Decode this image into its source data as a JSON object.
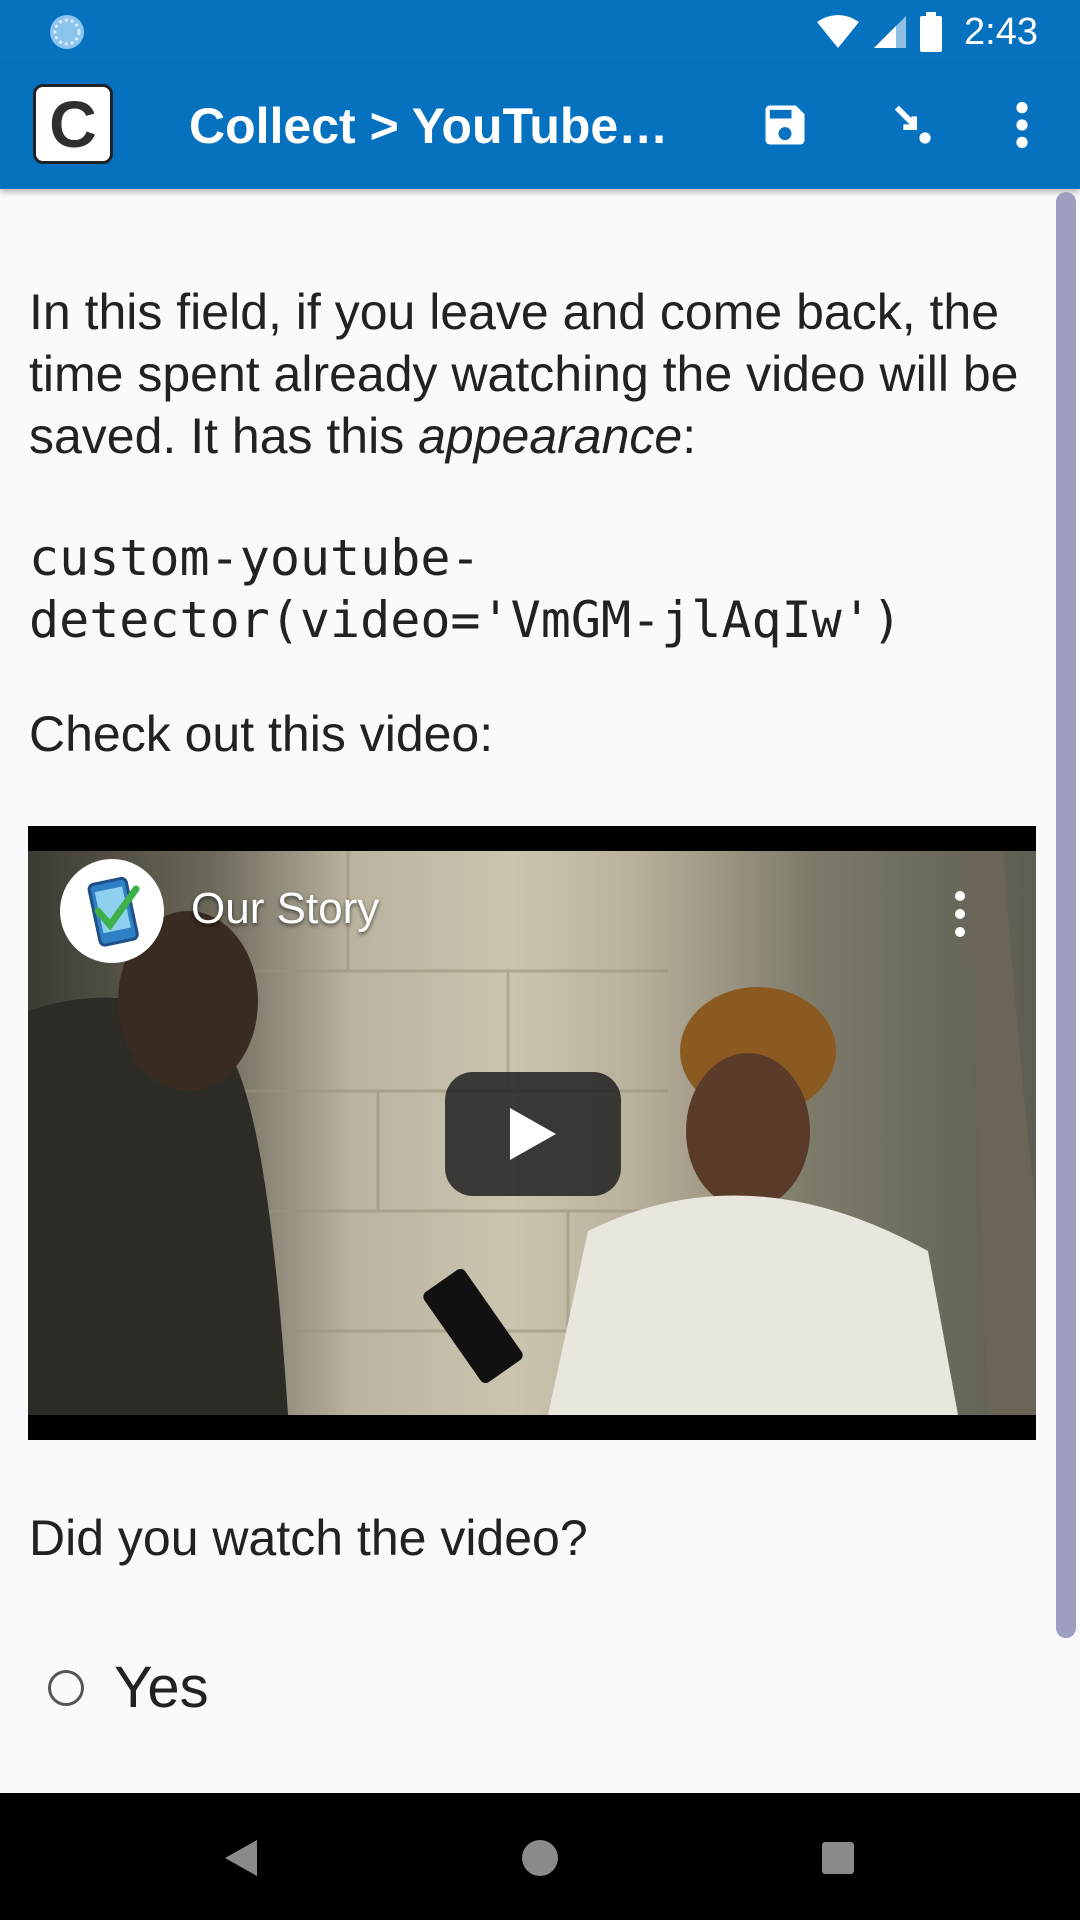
{
  "status_bar": {
    "time": "2:43",
    "icons": [
      "sync-icon",
      "wifi-icon",
      "cell-signal-icon",
      "battery-icon"
    ]
  },
  "app_bar": {
    "logo_letter": "C",
    "title": "Collect > YouTube…",
    "actions": [
      "save-icon",
      "jump-icon",
      "overflow-menu-icon"
    ]
  },
  "content": {
    "intro_text": "In this field, if you leave and come back, the time spent already watching the video will be saved. It has this ",
    "intro_emphasis": "appearance",
    "intro_suffix": ":",
    "appearance_code": "custom-youtube-\ndetector(video='VmGM-jlAqIw')",
    "video_prompt": "Check out this video:",
    "video": {
      "title": "Our Story"
    },
    "question": "Did you watch the video?",
    "options": [
      {
        "label": "Yes",
        "selected": false
      }
    ]
  },
  "colors": {
    "primary": "#0672bf",
    "scrollbar": "#9e9fbf",
    "text": "#222222"
  }
}
